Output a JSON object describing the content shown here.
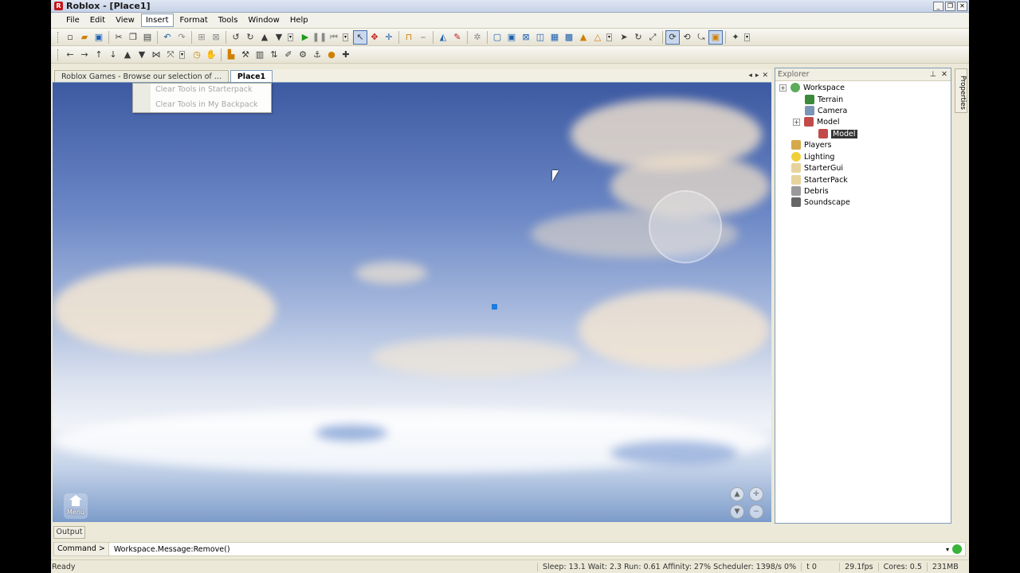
{
  "window": {
    "title": "Roblox - [Place1]",
    "controls": [
      "_",
      "❐",
      "✕"
    ]
  },
  "menu": [
    "File",
    "Edit",
    "View",
    "Insert",
    "Format",
    "Tools",
    "Window",
    "Help"
  ],
  "tabs": [
    "Roblox Games - Browse our selection of ...",
    "Place1"
  ],
  "dropdown": [
    "Clear Tools in Starterpack",
    "Clear Tools in My Backpack"
  ],
  "viewport": {
    "menu_label": "Menu"
  },
  "explorer": {
    "title": "Explorer",
    "nodes": [
      {
        "label": "Workspace",
        "color": "#5cab5c"
      },
      {
        "label": "Terrain",
        "color": "#3b8a3b"
      },
      {
        "label": "Camera",
        "color": "#7a95b6"
      },
      {
        "label": "Model",
        "color": "#c24a4a"
      },
      {
        "label": "Model",
        "color": "#c24a4a"
      },
      {
        "label": "Players",
        "color": "#d6a94a"
      },
      {
        "label": "Lighting",
        "color": "#f0cf3a"
      },
      {
        "label": "StarterGui",
        "color": "#e7d39c"
      },
      {
        "label": "StarterPack",
        "color": "#e7d39c"
      },
      {
        "label": "Debris",
        "color": "#9a9a9a"
      },
      {
        "label": "Soundscape",
        "color": "#666666"
      }
    ]
  },
  "properties_tab": "Properties",
  "output_tab": "Output",
  "command": {
    "label": "Command >",
    "value": "Workspace.Message:Remove()"
  },
  "status": {
    "ready": "Ready",
    "perf": "Sleep: 13.1 Wait: 2.3 Run: 0.61 Affinity: 27% Scheduler: 1398/s 0%",
    "t": "t 0",
    "fps": "29.1fps",
    "cores": "Cores: 0.5",
    "mem": "231MB"
  }
}
